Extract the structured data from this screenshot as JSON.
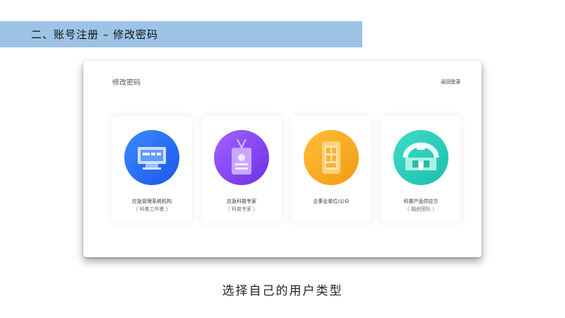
{
  "banner": {
    "title": "二、账号注册 – 修改密码"
  },
  "dialog": {
    "title": "修改密码",
    "back_link": "返回登录",
    "cards": [
      {
        "label": "应急管理系统机构",
        "sublabel": "（ 科普工作者 ）",
        "icon": "monitor-icon",
        "color": "#2f6ff5"
      },
      {
        "label": "应急科普专家",
        "sublabel": "（ 科普专家 ）",
        "icon": "badge-icon",
        "color": "#8a46f5"
      },
      {
        "label": "企事业单位/公众",
        "sublabel": "",
        "icon": "phone-icon",
        "color": "#f5a623"
      },
      {
        "label": "科普产品供应方",
        "sublabel": "（ 融创团队 ）",
        "icon": "storefront-icon",
        "color": "#2fd0bb"
      }
    ]
  },
  "caption": "选择自己的用户类型"
}
